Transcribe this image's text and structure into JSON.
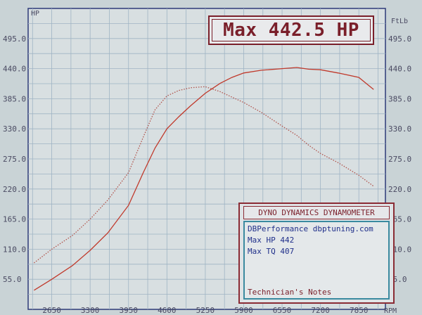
{
  "chart_data": {
    "type": "line",
    "title": "Max 442.5 HP",
    "left_unit": "HP",
    "right_unit": "FtLb",
    "x_unit": "RPM",
    "xlim": [
      2250,
      8300
    ],
    "ylim": [
      0,
      550
    ],
    "y_ticks": [
      "55.0",
      "110.0",
      "165.0",
      "220.0",
      "275.0",
      "330.0",
      "385.0",
      "440.0",
      "495.0"
    ],
    "right_ticks": [
      "55.0",
      "110.0",
      "165.0",
      "220.0",
      "275.0",
      "330.0",
      "385.0",
      "440.0",
      "495.0"
    ],
    "x_ticks": [
      "2650",
      "3300",
      "3950",
      "4600",
      "5250",
      "5900",
      "6550",
      "7200",
      "7850"
    ],
    "grid": true,
    "series": [
      {
        "color": "#c0392b",
        "style": "solid",
        "x": [
          2350,
          2650,
          3000,
          3300,
          3600,
          3950,
          4200,
          4400,
          4600,
          4800,
          5000,
          5250,
          5500,
          5700,
          5900,
          6200,
          6550,
          6800,
          7000,
          7200,
          7500,
          7850,
          8100
        ],
        "y": [
          35,
          55,
          80,
          108,
          140,
          190,
          250,
          295,
          330,
          352,
          372,
          395,
          413,
          424,
          432,
          437,
          440,
          442,
          439,
          438,
          432,
          424,
          402
        ]
      },
      {
        "color": "#b0524a",
        "style": "dotted",
        "x": [
          2350,
          2650,
          3000,
          3300,
          3600,
          3950,
          4200,
          4400,
          4600,
          4800,
          5000,
          5250,
          5500,
          5700,
          5900,
          6200,
          6550,
          6800,
          7000,
          7200,
          7500,
          7850,
          8100
        ],
        "y": [
          85,
          110,
          135,
          165,
          200,
          250,
          315,
          365,
          390,
          400,
          405,
          407,
          398,
          388,
          378,
          360,
          335,
          318,
          300,
          285,
          268,
          245,
          225
        ]
      }
    ]
  },
  "info": {
    "header": "DYNO DYNAMICS DYNAMOMETER",
    "line1": "DBPerformance dbptuning.com",
    "line2": "Max HP 442",
    "line3": "Max TQ 407",
    "note": "Technician's Notes"
  }
}
